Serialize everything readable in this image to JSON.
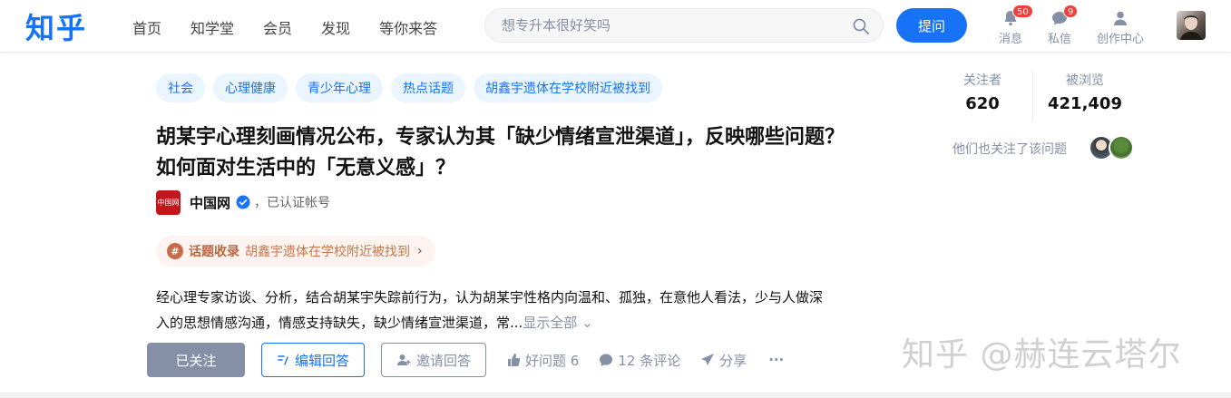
{
  "header": {
    "logo": "知乎",
    "nav": [
      "首页",
      "知学堂",
      "会员",
      "发现",
      "等你来答"
    ],
    "search_placeholder": "想专升本很好笑吗",
    "ask_label": "提问",
    "messages": {
      "label": "消息",
      "count": "50"
    },
    "private_messages": {
      "label": "私信",
      "count": "9"
    },
    "creator_label": "创作中心"
  },
  "question": {
    "topics": [
      "社会",
      "心理健康",
      "青少年心理",
      "热点话题",
      "胡鑫宇遗体在学校附近被找到"
    ],
    "title": "胡某宇心理刻画情况公布，专家认为其「缺少情绪宣泄渠道」，反映哪些问题？如何面对生活中的「无意义感」？",
    "author": {
      "logo_text": "中国网",
      "name": "中国网",
      "verified_text": "，已认证帐号"
    },
    "collection": {
      "label": "话题收录",
      "name": "胡鑫宇遗体在学校附近被找到"
    },
    "excerpt": "经心理专家访谈、分析，结合胡某宇失踪前行为，认为胡某宇性格内向温和、孤独，在意他人看法，少与人做深入的思想情感沟通，情感支持缺失，缺少情绪宣泄渠道，常...",
    "show_all": "显示全部 ⌄"
  },
  "actions": {
    "followed": "已关注",
    "edit_answer": "编辑回答",
    "invite": "邀请回答",
    "good_question": "好问题 6",
    "comments": "12 条评论",
    "share": "分享",
    "more": "···"
  },
  "sidebar": {
    "followers_label": "关注者",
    "followers": "620",
    "views_label": "被浏览",
    "views": "421,409",
    "also_followed": "他们也关注了该问题"
  },
  "watermark": "知乎 @赫连云塔尔",
  "colors": {
    "brand": "#1772f6",
    "badge": "#f1403c",
    "muted": "#8590a6"
  }
}
